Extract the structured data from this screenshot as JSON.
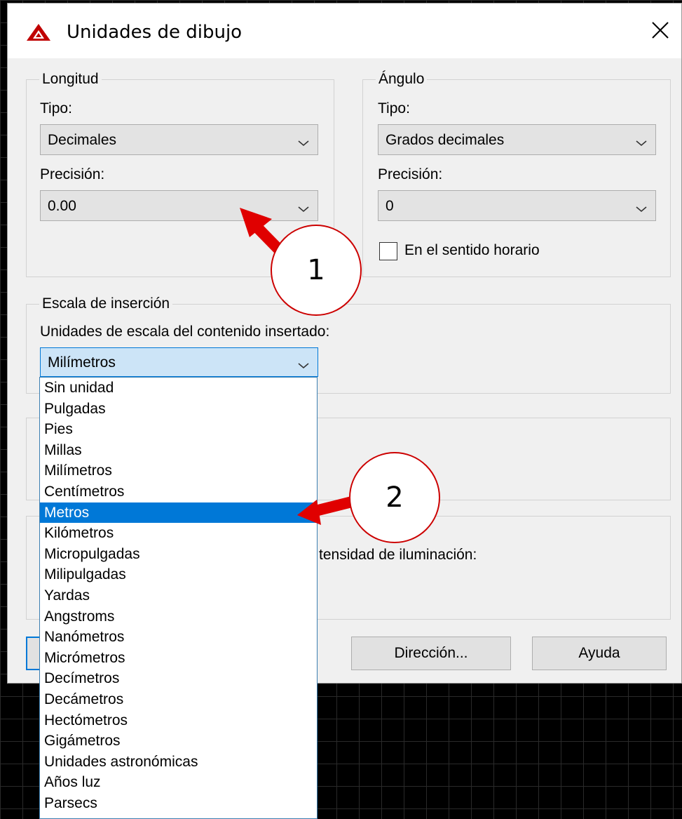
{
  "dialog": {
    "title": "Unidades de dibujo",
    "accent_color": "#c00000"
  },
  "length": {
    "group_label": "Longitud",
    "type_label": "Tipo:",
    "type_value": "Decimales",
    "precision_label": "Precisión:",
    "precision_value": "0.00"
  },
  "angle": {
    "group_label": "Ángulo",
    "type_label": "Tipo:",
    "type_value": "Grados decimales",
    "precision_label": "Precisión:",
    "precision_value": "0",
    "clockwise_label": "En el sentido horario",
    "clockwise_checked": false
  },
  "insertion": {
    "group_label": "Escala de inserción",
    "units_label": "Unidades de escala del contenido insertado:",
    "units_value": "Milímetros",
    "options": [
      "Sin unidad",
      "Pulgadas",
      "Pies",
      "Millas",
      "Milímetros",
      "Centímetros",
      "Metros",
      "Kilómetros",
      "Micropulgadas",
      "Milipulgadas",
      "Yardas",
      "Angstroms",
      "Nanómetros",
      "Micrómetros",
      "Decímetros",
      "Decámetros",
      "Hectómetros",
      "Gigámetros",
      "Unidades astronómicas",
      "Años luz",
      "Parsecs"
    ],
    "highlighted_option": "Metros"
  },
  "lighting": {
    "units_label_partial": "tensidad de iluminación:"
  },
  "buttons": {
    "direction": "Dirección...",
    "help": "Ayuda"
  },
  "annotations": {
    "marker_1": "1",
    "marker_2": "2",
    "color": "#e00000"
  },
  "background": {
    "color": "#000000",
    "grid_color": "#2a2a2a"
  }
}
